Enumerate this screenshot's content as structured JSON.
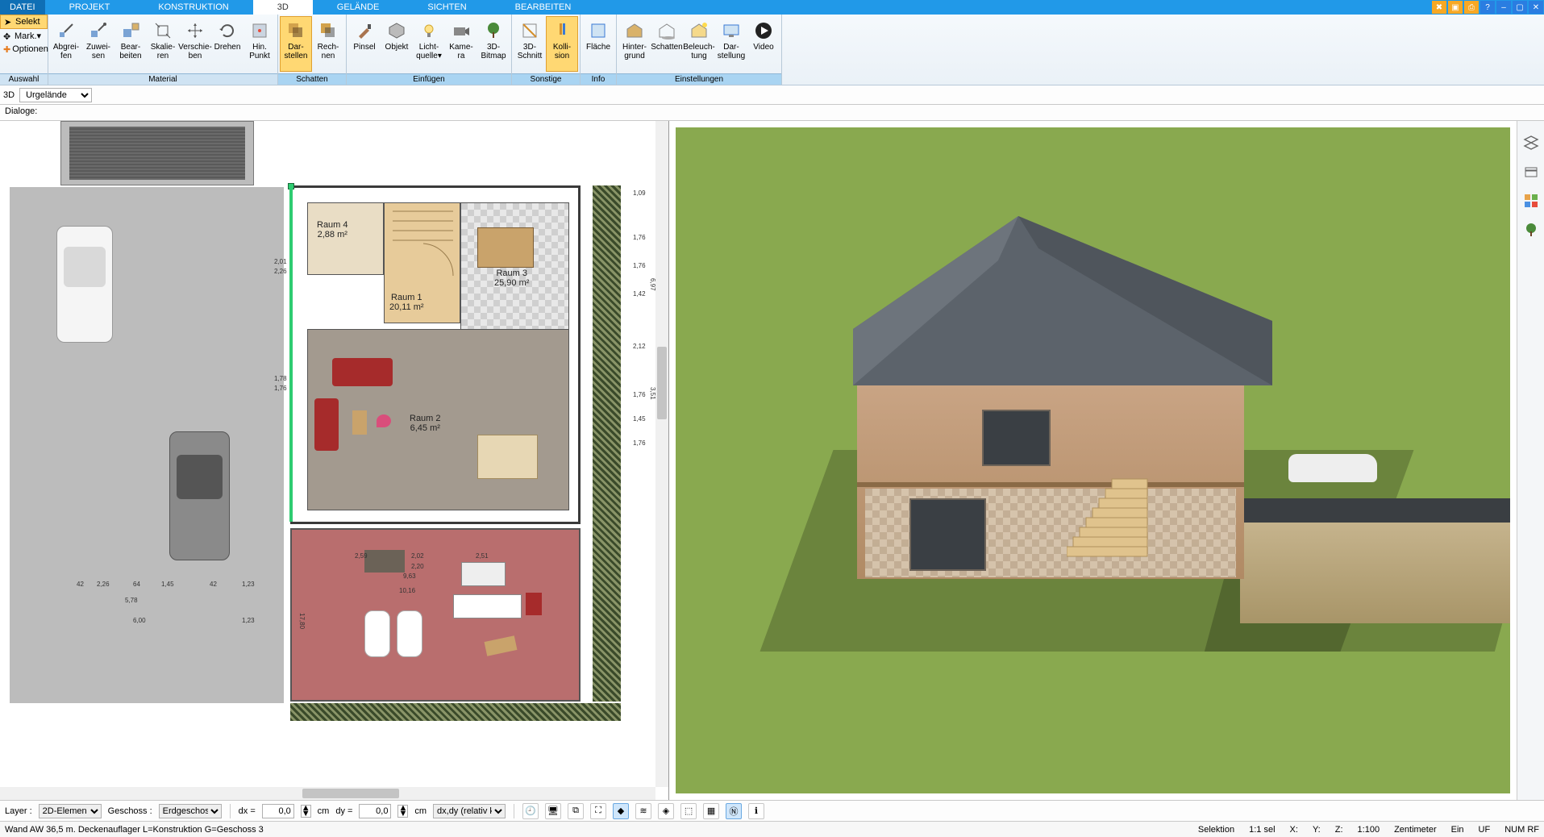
{
  "menu": {
    "tabs": [
      "DATEI",
      "PROJEKT",
      "KONSTRUKTION",
      "3D",
      "GELÄNDE",
      "SICHTEN",
      "BEARBEITEN"
    ],
    "active": 3
  },
  "auswahl": {
    "select": "Selekt",
    "mark": "Mark.",
    "options": "Optionen",
    "group": "Auswahl"
  },
  "ribbon": {
    "material": {
      "label": "Material",
      "buttons": [
        {
          "id": "abgreifen",
          "label": "Abgrei-\nfen"
        },
        {
          "id": "zuweisen",
          "label": "Zuwei-\nsen"
        },
        {
          "id": "bearbeiten",
          "label": "Bear-\nbeiten"
        },
        {
          "id": "skalieren",
          "label": "Skalie-\nren"
        },
        {
          "id": "verschieben",
          "label": "Verschie-\nben"
        },
        {
          "id": "drehen",
          "label": "Drehen"
        },
        {
          "id": "hin-punkt",
          "label": "Hin.\nPunkt"
        }
      ]
    },
    "schatten": {
      "label": "Schatten",
      "buttons": [
        {
          "id": "darstellen",
          "label": "Dar-\nstellen",
          "active": true
        },
        {
          "id": "rechnen",
          "label": "Rech-\nnen"
        }
      ]
    },
    "einfuegen": {
      "label": "Einfügen",
      "buttons": [
        {
          "id": "pinsel",
          "label": "Pinsel"
        },
        {
          "id": "objekt",
          "label": "Objekt"
        },
        {
          "id": "lichtquelle",
          "label": "Licht-\nquelle▾"
        },
        {
          "id": "kamera",
          "label": "Kame-\nra"
        },
        {
          "id": "bitmap3d",
          "label": "3D-\nBitmap"
        }
      ]
    },
    "sonstige": {
      "label": "Sonstige",
      "buttons": [
        {
          "id": "schnitt3d",
          "label": "3D-\nSchnitt"
        },
        {
          "id": "kollision",
          "label": "Kolli-\nsion",
          "active": true
        }
      ]
    },
    "info": {
      "label": "Info",
      "buttons": [
        {
          "id": "flaeche",
          "label": "Fläche"
        }
      ]
    },
    "einstellungen": {
      "label": "Einstellungen",
      "buttons": [
        {
          "id": "hintergrund",
          "label": "Hinter-\ngrund"
        },
        {
          "id": "schatten2",
          "label": "Schatten"
        },
        {
          "id": "beleuchtung",
          "label": "Beleuch-\ntung"
        },
        {
          "id": "darstellung",
          "label": "Dar-\nstellung"
        },
        {
          "id": "video",
          "label": "Video"
        }
      ]
    }
  },
  "subbar": {
    "mode": "3D",
    "layer_select": "Urgelände"
  },
  "dialogbar": {
    "label": "Dialoge:"
  },
  "floorplan": {
    "rooms": [
      {
        "name": "Raum 4",
        "area": "2,88 m²"
      },
      {
        "name": "Raum 1",
        "area": "20,11 m²"
      },
      {
        "name": "Raum 3",
        "area": "25,90 m²"
      },
      {
        "name": "Raum 2",
        "area": "6,45 m²"
      }
    ],
    "dims_left": [
      "2,01",
      "2,26",
      "1,78",
      "1,76"
    ],
    "dims_bottom": [
      "42",
      "2,26",
      "64",
      "1,45",
      "42",
      "1,23",
      "5,78",
      "6,00",
      "1,23"
    ],
    "dims_right": [
      "1,09",
      "1,76",
      "1,76",
      "1,42",
      "2,12",
      "1,76",
      "1,45",
      "1,76",
      "6,97",
      "3,51"
    ],
    "dims_center": [
      "2,59",
      "2,02",
      "2,51",
      "2,20",
      "9,63",
      "17,80",
      "10,16"
    ]
  },
  "bottombar": {
    "layer_label": "Layer :",
    "layer_value": "2D-Elemen",
    "geschoss_label": "Geschoss :",
    "geschoss_value": "Erdgeschos",
    "dx_label": "dx =",
    "dx_value": "0,0",
    "dy_label": "dy =",
    "dy_value": "0,0",
    "unit": "cm",
    "mode": "dx,dy (relativ ka"
  },
  "statusbar": {
    "left": "Wand AW 36,5 m. Deckenauflager L=Konstruktion G=Geschoss 3",
    "selektion": "Selektion",
    "ratio": "1:1 sel",
    "x": "X:",
    "y": "Y:",
    "z": "Z:",
    "scale": "1:100",
    "unit": "Zentimeter",
    "ein": "Ein",
    "uf": "UF",
    "num": "NUM RF"
  }
}
